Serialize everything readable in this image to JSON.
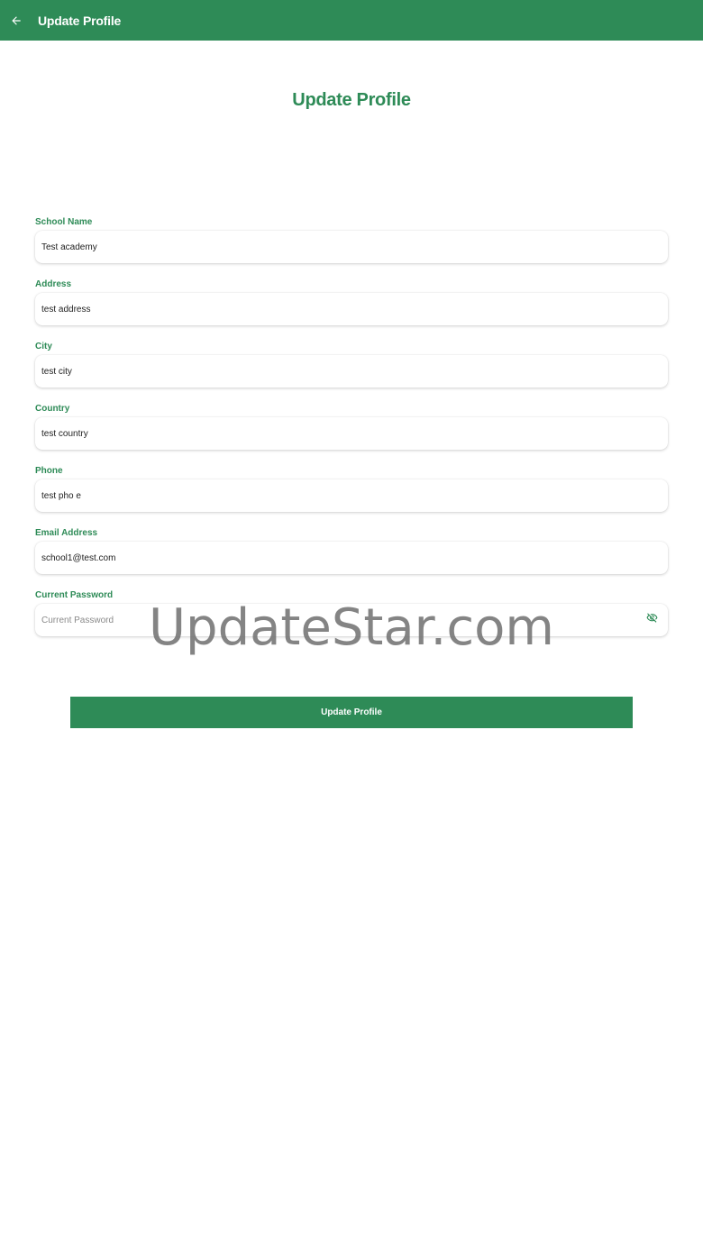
{
  "app_bar": {
    "title": "Update Profile",
    "back_icon": "arrow-left-icon"
  },
  "heading": "Update Profile",
  "fields": [
    {
      "label": "School Name",
      "value": "Test academy",
      "placeholder": ""
    },
    {
      "label": "Address",
      "value": "test address",
      "placeholder": ""
    },
    {
      "label": "City",
      "value": "test city",
      "placeholder": ""
    },
    {
      "label": "Country",
      "value": "test country",
      "placeholder": ""
    },
    {
      "label": "Phone",
      "value": "test pho e",
      "placeholder": ""
    },
    {
      "label": "Email Address",
      "value": "school1@test.com",
      "placeholder": ""
    },
    {
      "label": "Current Password",
      "value": "",
      "placeholder": "Current Password",
      "icon": "eye-off-icon"
    }
  ],
  "submit_label": "Update Profile",
  "watermark": "UpdateStar.com",
  "colors": {
    "primary": "#2e8b57",
    "on_primary": "#ffffff"
  }
}
